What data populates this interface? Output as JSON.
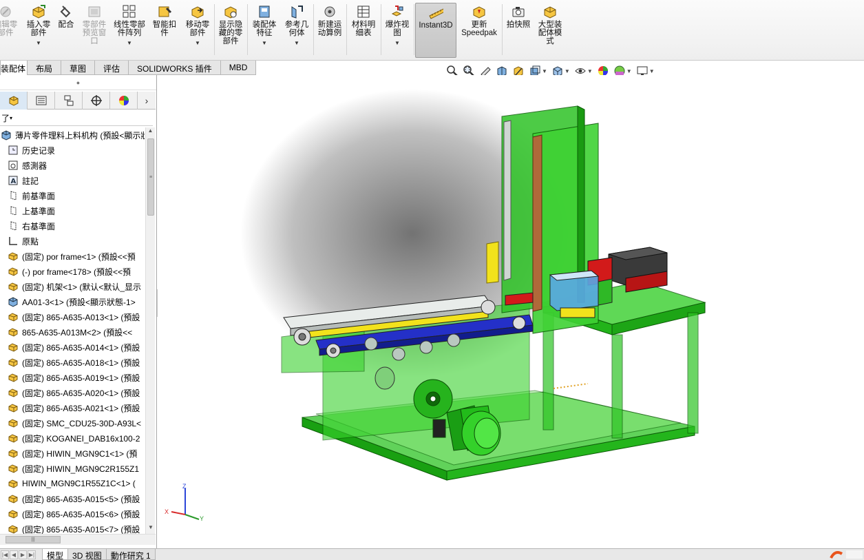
{
  "ribbon": {
    "buttons": [
      {
        "label": "编辑零\n部件",
        "icon": "edit-component-icon",
        "disabled": true,
        "dropdown": false
      },
      {
        "label": "插入零\n部件",
        "icon": "insert-components-icon",
        "disabled": false,
        "dropdown": true
      },
      {
        "label": "配合",
        "icon": "mate-icon",
        "disabled": false,
        "dropdown": false
      },
      {
        "label": "零部件\n预览窗\n口",
        "icon": "component-preview-icon",
        "disabled": true,
        "dropdown": false
      },
      {
        "label": "线性零部\n件阵列",
        "icon": "linear-pattern-icon",
        "disabled": false,
        "dropdown": true
      },
      {
        "label": "智能扣\n件",
        "icon": "smart-fasteners-icon",
        "disabled": false,
        "dropdown": false
      },
      {
        "label": "移动零\n部件",
        "icon": "move-component-icon",
        "disabled": false,
        "dropdown": true
      },
      {
        "label": "显示隐\n藏的零\n部件",
        "icon": "show-hidden-icon",
        "disabled": false,
        "dropdown": false
      },
      {
        "label": "装配体\n特征",
        "icon": "assembly-features-icon",
        "disabled": false,
        "dropdown": true
      },
      {
        "label": "参考几\n何体",
        "icon": "reference-geometry-icon",
        "disabled": false,
        "dropdown": true
      },
      {
        "label": "新建运\n动算例",
        "icon": "motion-study-icon",
        "disabled": false,
        "dropdown": false
      },
      {
        "label": "材料明\n细表",
        "icon": "bom-icon",
        "disabled": false,
        "dropdown": false
      },
      {
        "label": "爆炸视\n图",
        "icon": "exploded-view-icon",
        "disabled": false,
        "dropdown": true
      },
      {
        "label": "Instant3D",
        "icon": "instant3d-icon",
        "disabled": false,
        "dropdown": false,
        "active": true
      },
      {
        "label": "更新\nSpeedpak",
        "icon": "speedpak-icon",
        "disabled": false,
        "dropdown": false
      },
      {
        "label": "拍快照",
        "icon": "snapshot-icon",
        "disabled": false,
        "dropdown": false
      },
      {
        "label": "大型装\n配体模\n式",
        "icon": "large-assembly-icon",
        "disabled": false,
        "dropdown": false
      }
    ]
  },
  "command_tabs": [
    "装配体",
    "布局",
    "草图",
    "评估",
    "SOLIDWORKS 插件",
    "MBD"
  ],
  "active_command_tab": 0,
  "view_toolbar": [
    "zoom-to-fit-icon",
    "zoom-to-area-icon",
    "previous-view-icon",
    "section-view-icon",
    "dynamic-annotation-icon",
    "view-orientation-icon",
    "display-style-icon",
    "hide-show-items-icon",
    "edit-appearance-icon",
    "apply-scene-icon",
    "view-settings-icon"
  ],
  "feature_manager": {
    "tabs": [
      "featuremanager-tab-icon",
      "propertymanager-tab-icon",
      "configurationmanager-tab-icon",
      "dimxpert-tab-icon",
      "display-manager-tab-icon"
    ],
    "filter_symbol": "了",
    "tree": [
      {
        "text": "薄片零件理料上料机构 (預設<顯示狀",
        "icon": "assembly-icon",
        "indent": 0
      },
      {
        "text": "历史记录",
        "icon": "history-icon",
        "indent": 1
      },
      {
        "text": "感測器",
        "icon": "sensor-icon",
        "indent": 1
      },
      {
        "text": "註記",
        "icon": "annotation-icon",
        "indent": 1
      },
      {
        "text": "前基準面",
        "icon": "plane-icon",
        "indent": 1
      },
      {
        "text": "上基準面",
        "icon": "plane-icon",
        "indent": 1
      },
      {
        "text": "右基準面",
        "icon": "plane-icon",
        "indent": 1
      },
      {
        "text": "原點",
        "icon": "origin-icon",
        "indent": 1
      },
      {
        "text": "(固定) por frame<1> (預設<<預",
        "icon": "part-icon",
        "indent": 1
      },
      {
        "text": "(-) por frame<178> (預設<<預",
        "icon": "part-icon",
        "indent": 1
      },
      {
        "text": "(固定) 机架<1> (默认<默认_显示",
        "icon": "part-icon",
        "indent": 1
      },
      {
        "text": "AA01-3<1> (預設<顯示狀態-1>",
        "icon": "subassembly-icon",
        "indent": 1
      },
      {
        "text": "(固定) 865-A635-A013<1> (預設",
        "icon": "part-icon",
        "indent": 1
      },
      {
        "text": "865-A635-A013M<2> (預設<<",
        "icon": "part-icon",
        "indent": 1
      },
      {
        "text": "(固定) 865-A635-A014<1> (預設",
        "icon": "part-icon",
        "indent": 1
      },
      {
        "text": "(固定) 865-A635-A018<1> (預設",
        "icon": "part-icon",
        "indent": 1
      },
      {
        "text": "(固定) 865-A635-A019<1> (預設",
        "icon": "part-icon",
        "indent": 1
      },
      {
        "text": "(固定) 865-A635-A020<1> (預設",
        "icon": "part-icon",
        "indent": 1
      },
      {
        "text": "(固定) 865-A635-A021<1> (預設",
        "icon": "part-icon",
        "indent": 1
      },
      {
        "text": "(固定) SMC_CDU25-30D-A93L<",
        "icon": "part-icon",
        "indent": 1
      },
      {
        "text": "(固定) KOGANEI_DAB16x100-2",
        "icon": "part-icon",
        "indent": 1
      },
      {
        "text": "(固定) HIWIN_MGN9C1<1> (預",
        "icon": "part-icon",
        "indent": 1
      },
      {
        "text": "(固定) HIWIN_MGN9C2R155Z1",
        "icon": "part-icon",
        "indent": 1
      },
      {
        "text": "HIWIN_MGN9C1R55Z1C<1> (",
        "icon": "part-icon",
        "indent": 1
      },
      {
        "text": "(固定) 865-A635-A015<5> (預設",
        "icon": "part-icon",
        "indent": 1
      },
      {
        "text": "(固定) 865-A635-A015<6> (預設",
        "icon": "part-icon",
        "indent": 1
      },
      {
        "text": "(固定) 865-A635-A015<7> (預設",
        "icon": "part-icon",
        "indent": 1
      }
    ]
  },
  "bottom_tabs": [
    "模型",
    "3D 视图",
    "動作研究 1"
  ],
  "active_bottom_tab": 0,
  "triad": {
    "x": "X",
    "y": "Y",
    "z": "Z"
  },
  "colors": {
    "model_green": "#22c51a",
    "conveyor_blue": "#1e2fc8",
    "rail_yellow": "#f2e21c",
    "ribbon_bg": "#f3f3f3"
  }
}
